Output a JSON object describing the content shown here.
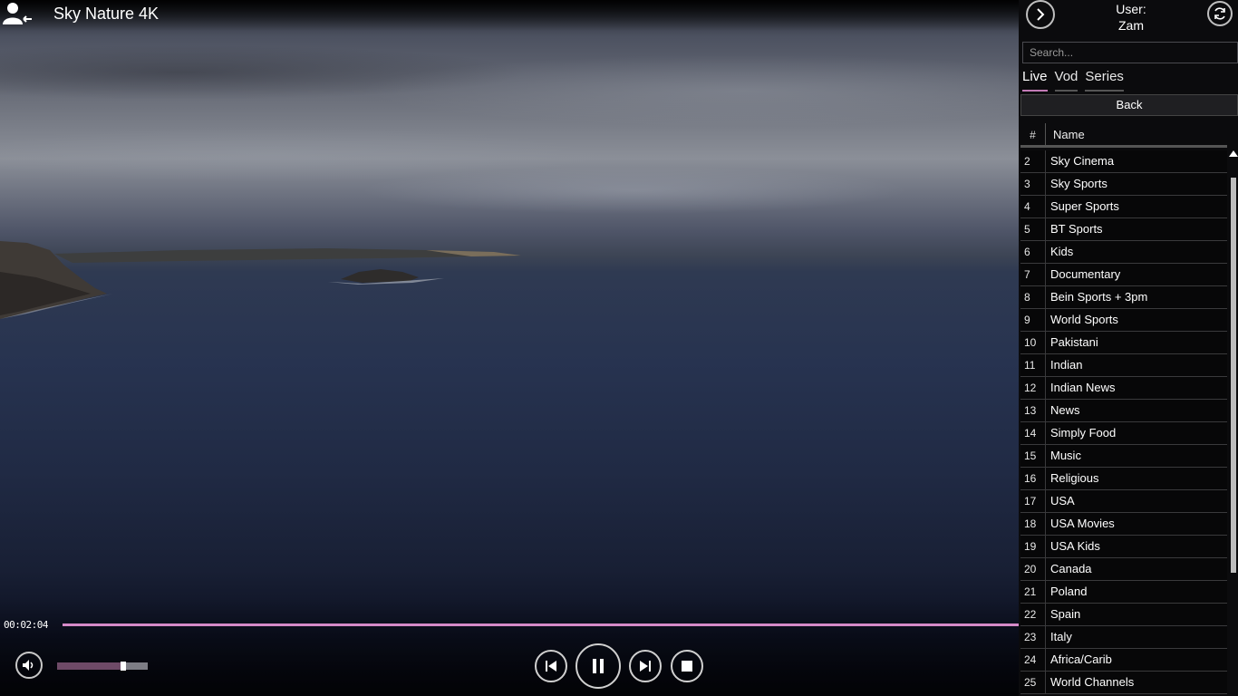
{
  "header": {
    "title": "Sky Nature 4K",
    "back_icon": "user-arrow-icon"
  },
  "player": {
    "elapsed": "00:02:04",
    "progress": 1.0,
    "volume": 0.73,
    "controls": [
      "previous-icon",
      "pause-icon",
      "next-icon",
      "stop-icon"
    ],
    "accent_color": "#c27bb6"
  },
  "panel": {
    "user_label": "User:",
    "user_name": "Zam",
    "search_placeholder": "Search...",
    "tabs": [
      {
        "label": "Live",
        "active": true
      },
      {
        "label": "Vod",
        "active": false
      },
      {
        "label": "Series",
        "active": false
      }
    ],
    "back_label": "Back",
    "columns": {
      "num": "#",
      "name": "Name"
    },
    "channels": [
      {
        "num": "2",
        "name": "Sky Cinema"
      },
      {
        "num": "3",
        "name": "Sky Sports"
      },
      {
        "num": "4",
        "name": "Super Sports"
      },
      {
        "num": "5",
        "name": "BT Sports"
      },
      {
        "num": "6",
        "name": "Kids"
      },
      {
        "num": "7",
        "name": "Documentary"
      },
      {
        "num": "8",
        "name": "Bein Sports + 3pm"
      },
      {
        "num": "9",
        "name": "World Sports"
      },
      {
        "num": "10",
        "name": "Pakistani"
      },
      {
        "num": "11",
        "name": "Indian"
      },
      {
        "num": "12",
        "name": "Indian News"
      },
      {
        "num": "13",
        "name": "News"
      },
      {
        "num": "14",
        "name": "Simply Food"
      },
      {
        "num": "15",
        "name": "Music"
      },
      {
        "num": "16",
        "name": "Religious"
      },
      {
        "num": "17",
        "name": "USA"
      },
      {
        "num": "18",
        "name": "USA Movies"
      },
      {
        "num": "19",
        "name": "USA Kids"
      },
      {
        "num": "20",
        "name": "Canada"
      },
      {
        "num": "21",
        "name": "Poland"
      },
      {
        "num": "22",
        "name": "Spain"
      },
      {
        "num": "23",
        "name": "Italy"
      },
      {
        "num": "24",
        "name": "Africa/Carib"
      },
      {
        "num": "25",
        "name": "World Channels"
      }
    ]
  }
}
